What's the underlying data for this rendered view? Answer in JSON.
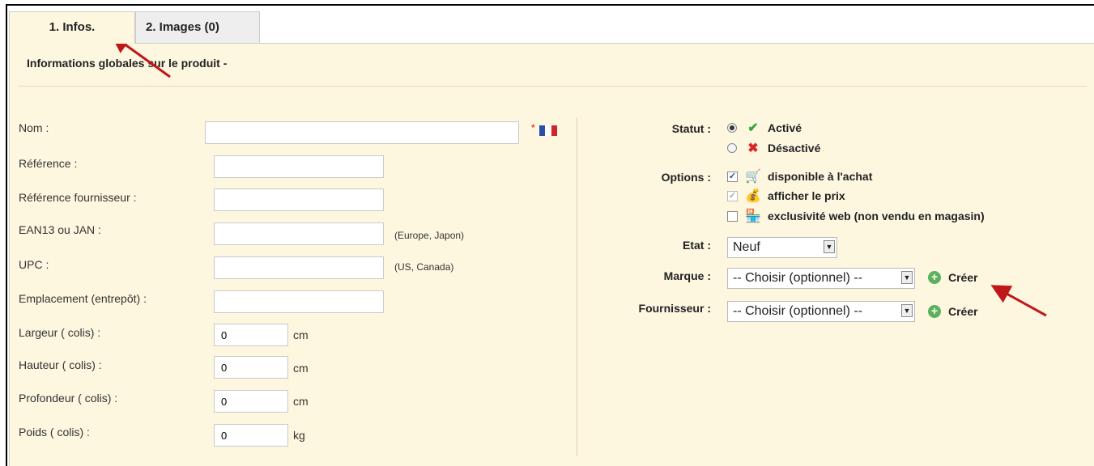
{
  "tabs": [
    {
      "label": "1. Infos.",
      "active": true
    },
    {
      "label": "2. Images (0)",
      "active": false
    }
  ],
  "section_title": "Informations globales sur le produit -",
  "fields": {
    "nom": {
      "label": "Nom :",
      "value": "",
      "required_mark": "*"
    },
    "reference": {
      "label": "Référence :",
      "value": ""
    },
    "ref_fournisseur": {
      "label": "Référence fournisseur :",
      "value": ""
    },
    "ean13": {
      "label": "EAN13 ou JAN :",
      "value": "",
      "hint": "(Europe, Japon)"
    },
    "upc": {
      "label": "UPC :",
      "value": "",
      "hint": "(US, Canada)"
    },
    "emplacement": {
      "label": "Emplacement (entrepôt) :",
      "value": ""
    },
    "largeur": {
      "label": "Largeur ( colis) :",
      "value": "0",
      "unit": "cm"
    },
    "hauteur": {
      "label": "Hauteur ( colis) :",
      "value": "0",
      "unit": "cm"
    },
    "profondeur": {
      "label": "Profondeur ( colis) :",
      "value": "0",
      "unit": "cm"
    },
    "poids": {
      "label": "Poids ( colis) :",
      "value": "0",
      "unit": "kg"
    }
  },
  "right": {
    "statut_label": "Statut :",
    "statut_options": [
      "Activé",
      "Désactivé"
    ],
    "statut_selected": "Activé",
    "options_label": "Options :",
    "options": [
      {
        "label": "disponible à l'achat",
        "checked": true,
        "disabled": false
      },
      {
        "label": "afficher le prix",
        "checked": true,
        "disabled": true
      },
      {
        "label": "exclusivité web (non vendu en magasin)",
        "checked": false,
        "disabled": false
      }
    ],
    "etat_label": "Etat :",
    "etat_value": "Neuf",
    "marque_label": "Marque :",
    "marque_value": "-- Choisir (optionnel) --",
    "fournisseur_label": "Fournisseur :",
    "fournisseur_value": "-- Choisir (optionnel) --",
    "create_label": "Créer"
  },
  "colors": {
    "panel_bg": "#fdf7e0",
    "inactive_tab_bg": "#eeeeee",
    "arrow": "#c0171b",
    "check_green": "#3aa43a",
    "cross_red": "#d9262a",
    "plus_green": "#5db15d"
  }
}
